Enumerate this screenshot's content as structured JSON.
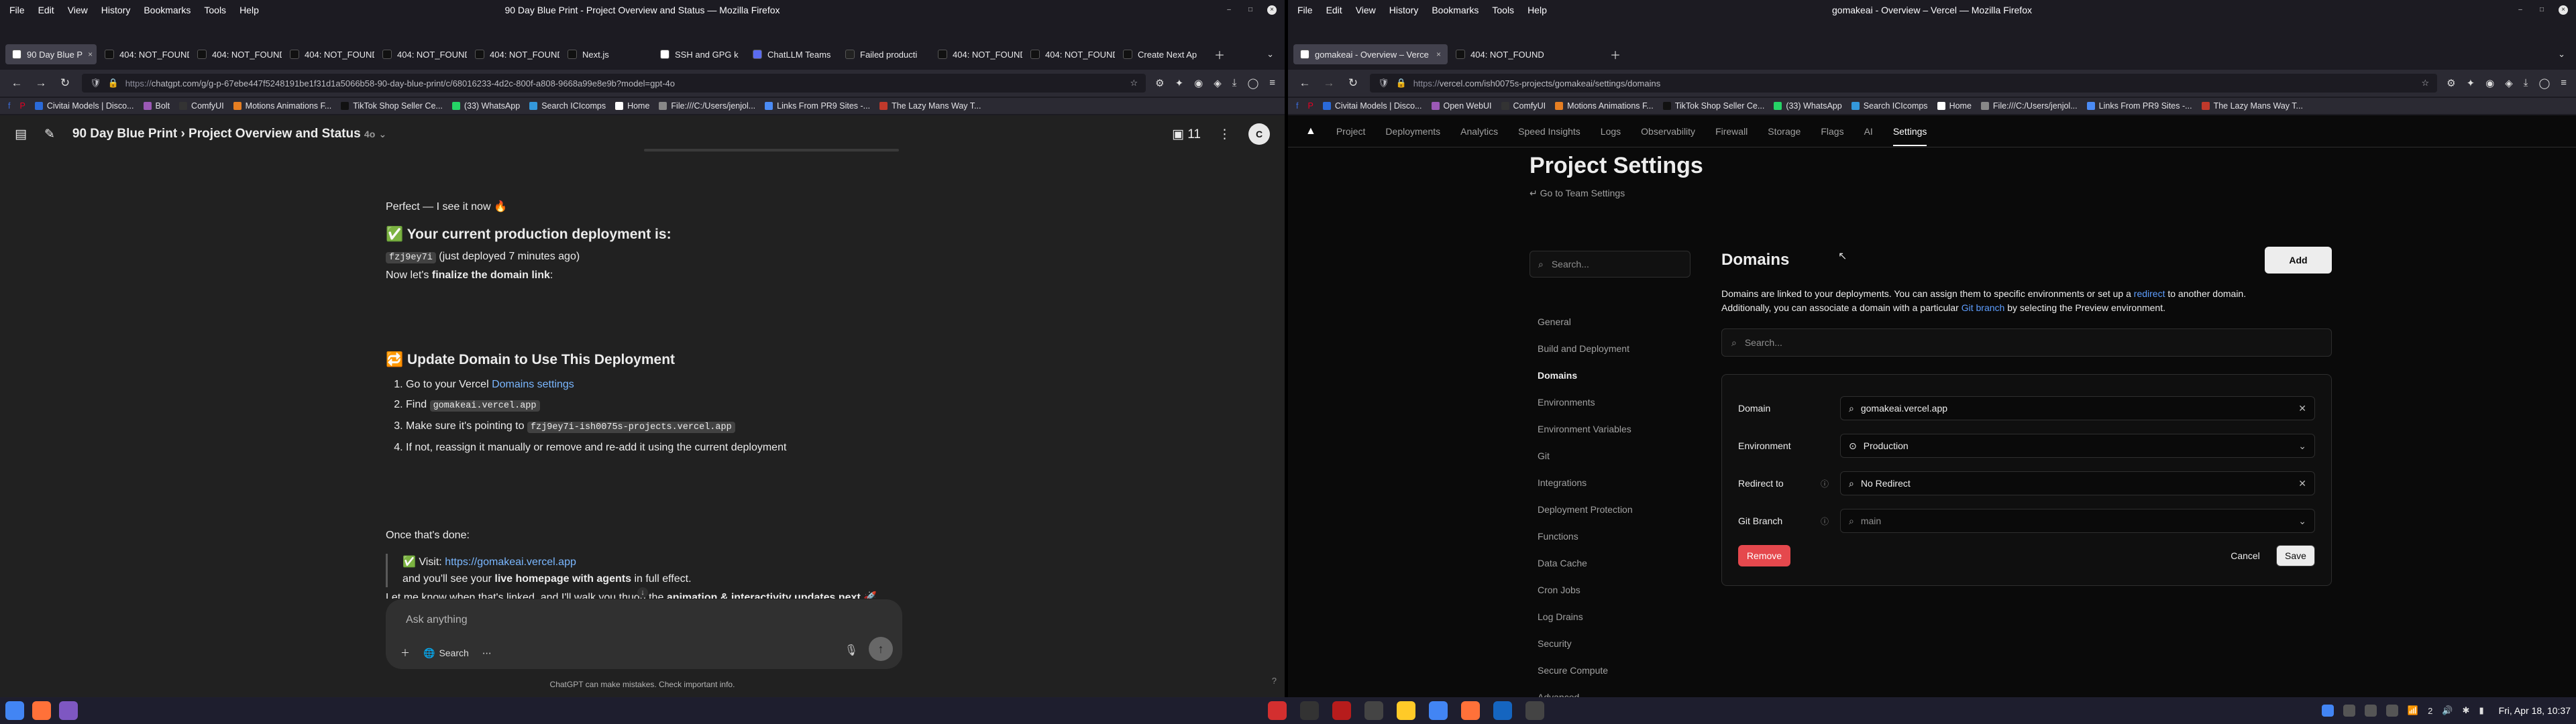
{
  "left_window": {
    "title": "90 Day Blue Print - Project Overview and Status — Mozilla Firefox",
    "menu": [
      "File",
      "Edit",
      "View",
      "History",
      "Bookmarks",
      "Tools",
      "Help"
    ],
    "tabs": [
      {
        "label": "90 Day Blue P",
        "color": "#ffffff",
        "active": true
      },
      {
        "label": "404: NOT_FOUND",
        "color": "#111111"
      },
      {
        "label": "404: NOT_FOUND",
        "color": "#111111"
      },
      {
        "label": "404: NOT_FOUND",
        "color": "#111111"
      },
      {
        "label": "404: NOT_FOUND",
        "color": "#111111"
      },
      {
        "label": "404: NOT_FOUND",
        "color": "#111111"
      },
      {
        "label": "Next.js",
        "color": "#111111"
      },
      {
        "label": "SSH and GPG k",
        "color": "#ffffff"
      },
      {
        "label": "ChatLLM Teams",
        "color": "#5b6cf0"
      },
      {
        "label": "Failed producti",
        "color": "#222222"
      },
      {
        "label": "404: NOT_FOUND",
        "color": "#111111"
      },
      {
        "label": "404: NOT_FOUND",
        "color": "#111111"
      },
      {
        "label": "Create Next Ap",
        "color": "#111111"
      }
    ],
    "url_prefix": "https://",
    "url_rest": "chatgpt.com/g/g-p-67ebe447f5248191be1f31d1a5066b58-90-day-blue-print/c/68016233-4d2c-800f-a808-9668a99e8e9b?model=gpt-4o",
    "bookmarks": [
      "Civitai Models | Disco...",
      "Bolt",
      "ComfyUI",
      "Motions Animations F...",
      "TikTok Shop Seller Ce...",
      "(33) WhatsApp",
      "Search ICIcomps",
      "Home",
      "File:///C:/Users/jenjol...",
      "Links From PR9 Sites -...",
      "The Lazy Mans Way T..."
    ]
  },
  "chat": {
    "project": "90 Day Blue Print",
    "separator": "›",
    "conversation": "Project Overview and Status",
    "model": "4o",
    "count": "11",
    "avatar": "C",
    "intro": "Perfect — I see it now 🔥",
    "deploy_heading": "✅ Your current production deployment is:",
    "deploy_id": "fzj9ey7i",
    "deploy_note": "(just deployed 7 minutes ago)",
    "finalize_pre": "Now let's",
    "finalize_bold": "finalize the domain link",
    "finalize_post": ":",
    "update_heading": "🔁 Update Domain to Use This Deployment",
    "step1_pre": "Go to your Vercel",
    "step1_link": "Domains settings",
    "step2_pre": "Find",
    "step2_code": "gomakeai.vercel.app",
    "step3_pre": "Make sure it's pointing to",
    "step3_code": "fzj9ey7i-ish0075s-projects.vercel.app",
    "step4": "If not, reassign it manually or remove and re-add it using the current deployment",
    "once_done": "Once that's done:",
    "visit_pre": "✅ Visit:",
    "visit_link": "https://gomakeai.vercel.app",
    "see_pre": "and you'll see your",
    "see_bold": "live homepage with agents",
    "see_post": "in full effect.",
    "letme_pre": "Let me know when that's linked, and I'll walk you th",
    "letme_mid": "ugh the",
    "letme_bold": "animation & interactivity updates next",
    "letme_post": "🚀",
    "composer_placeholder": "Ask anything",
    "search_label": "Search",
    "disclaimer": "ChatGPT can make mistakes. Check important info."
  },
  "right_window": {
    "title": "gomakeai - Overview – Vercel — Mozilla Firefox",
    "menu": [
      "File",
      "Edit",
      "View",
      "History",
      "Bookmarks",
      "Tools",
      "Help"
    ],
    "tabs": [
      {
        "label": "gomakeai - Overview – Verce",
        "color": "#ffffff",
        "active": true
      },
      {
        "label": "404: NOT_FOUND",
        "color": "#111111"
      }
    ],
    "url_prefix": "https://",
    "url_rest": "vercel.com/ish0075s-projects/gomakeai/settings/domains",
    "bookmarks": [
      "Civitai Models | Disco...",
      "Open WebUI",
      "ComfyUI",
      "Motions Animations F...",
      "TikTok Shop Seller Ce...",
      "(33) WhatsApp",
      "Search ICIcomps",
      "Home",
      "File:///C:/Users/jenjol...",
      "Links From PR9 Sites -...",
      "The Lazy Mans Way T..."
    ]
  },
  "vercel": {
    "nav": [
      "Project",
      "Deployments",
      "Analytics",
      "Speed Insights",
      "Logs",
      "Observability",
      "Firewall",
      "Storage",
      "Flags",
      "AI",
      "Settings"
    ],
    "active_nav": "Settings",
    "title": "Project Settings",
    "back": "Go to Team Settings",
    "search_placeholder": "Search...",
    "sidebar": [
      "General",
      "Build and Deployment",
      "Domains",
      "Environments",
      "Environment Variables",
      "Git",
      "Integrations",
      "Deployment Protection",
      "Functions",
      "Data Cache",
      "Cron Jobs",
      "Log Drains",
      "Security",
      "Secure Compute",
      "Advanced"
    ],
    "sidebar_selected": "Domains",
    "heading": "Domains",
    "add_label": "Add",
    "desc_1": "Domains are linked to your deployments. You can assign them to specific environments or set up a",
    "desc_link1": "redirect",
    "desc_2": "to another domain.",
    "desc_3": "Additionally, you can associate a domain with a particular",
    "desc_link2": "Git branch",
    "desc_4": "by selecting the Preview environment.",
    "domain_search_placeholder": "Search...",
    "form": {
      "domain_label": "Domain",
      "domain_value": "gomakeai.vercel.app",
      "environment_label": "Environment",
      "environment_value": "Production",
      "redirect_label": "Redirect to",
      "redirect_value": "No Redirect",
      "branch_label": "Git Branch",
      "branch_value": "main"
    },
    "remove_label": "Remove",
    "cancel_label": "Cancel",
    "save_label": "Save"
  },
  "taskbar": {
    "wifi_count": "2",
    "clock": "Fri, Apr 18, 10:37"
  },
  "colors": {
    "chat_bg": "#212121",
    "vercel_bg": "#0a0a0a",
    "firefox_chrome": "#2b2a33",
    "link_blue": "#7ab7ff",
    "remove_red": "#e5484d"
  }
}
